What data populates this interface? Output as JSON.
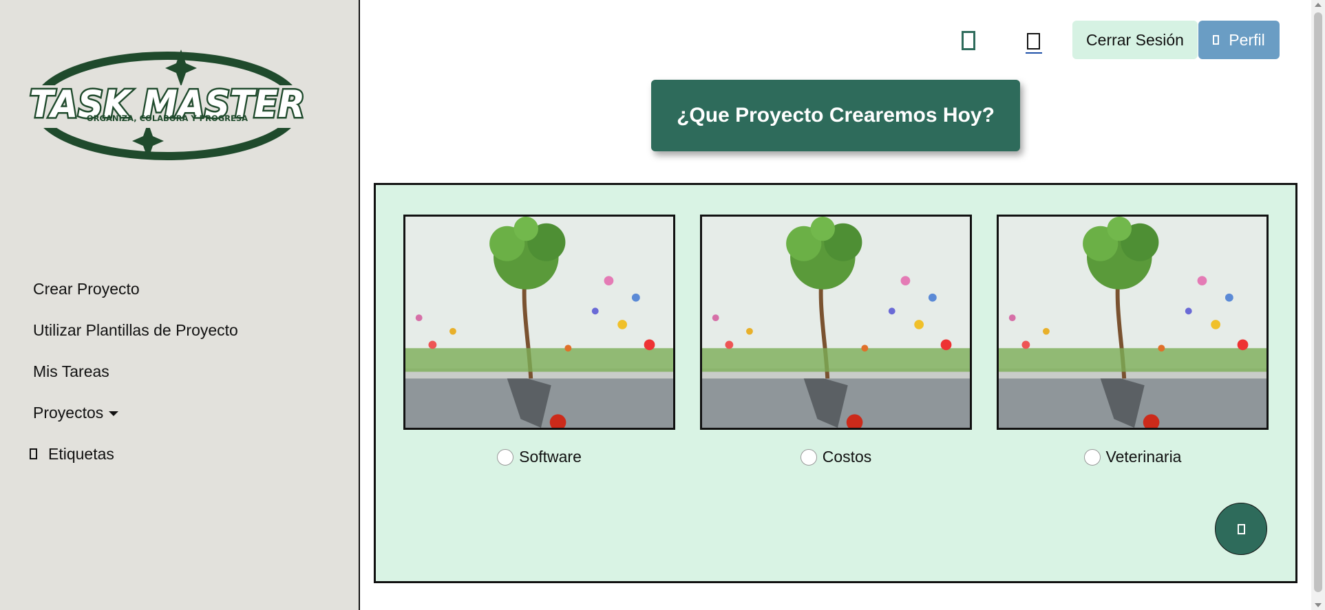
{
  "brand": {
    "logo_title": "TASK MASTER",
    "logo_tagline": "ORGANIZA, COLABORA Y PROGRESA"
  },
  "sidebar": {
    "items": [
      {
        "label": "Crear Proyecto"
      },
      {
        "label": "Utilizar Plantillas de Proyecto"
      },
      {
        "label": "Mis Tareas"
      },
      {
        "label": "Proyectos"
      },
      {
        "label": "Etiquetas"
      }
    ]
  },
  "header": {
    "logout_label": "Cerrar Sesión",
    "profile_label": "Perfil"
  },
  "hero": {
    "title": "¿Que Proyecto Crearemos Hoy?"
  },
  "templates": [
    {
      "label": "Software"
    },
    {
      "label": "Costos"
    },
    {
      "label": "Veterinaria"
    }
  ],
  "colors": {
    "accent": "#2e6b5b",
    "sidebar_bg": "#e2e1dc",
    "panel_bg": "#d9f3e4",
    "profile_button": "#6a9dc4",
    "logout_button": "#d6f2e3"
  }
}
